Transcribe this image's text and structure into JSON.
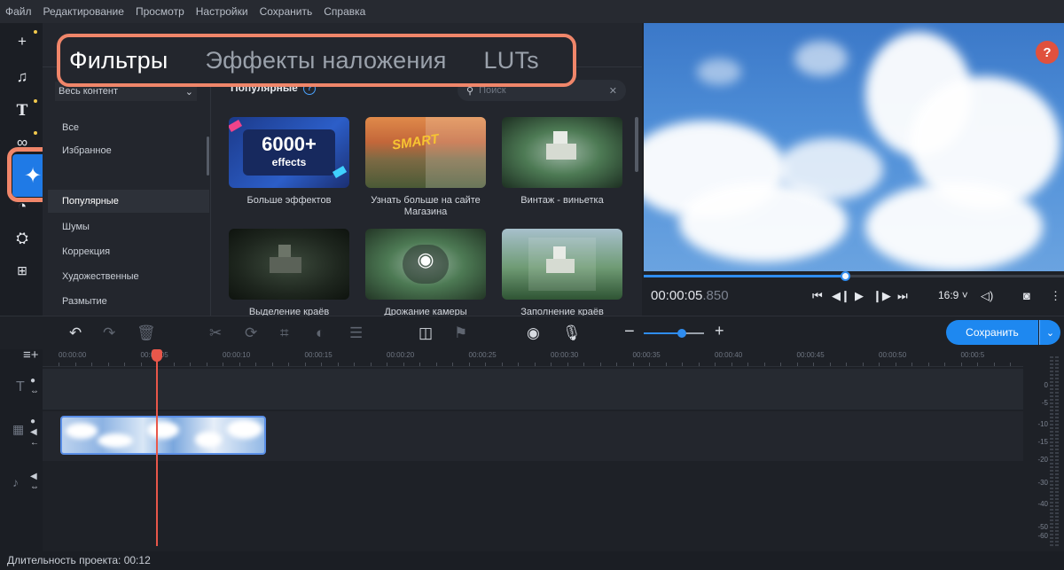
{
  "menu": [
    "Файл",
    "Редактирование",
    "Просмотр",
    "Настройки",
    "Сохранить",
    "Справка"
  ],
  "rail": {
    "icons": [
      "add-media-icon",
      "music-icon",
      "titles-icon",
      "transitions-icon",
      "filters-icon",
      "stickers-icon",
      "callouts-icon",
      "more-tools-icon"
    ]
  },
  "panel": {
    "tabs": [
      {
        "label": "Фильтры",
        "active": true
      },
      {
        "label": "Эффекты наложения",
        "active": false
      },
      {
        "label": "LUTs",
        "active": false
      }
    ],
    "content_filter": "Весь контент",
    "categories": [
      "Все",
      "Избранное",
      "Популярные",
      "Шумы",
      "Коррекция",
      "Художественные",
      "Размытие"
    ],
    "selected_category": "Популярные",
    "section_title": "Популярные",
    "search_placeholder": "Поиск",
    "tiles": [
      {
        "label": "Больше эффектов",
        "badge_main": "6000+",
        "badge_sub": "effects"
      },
      {
        "label": "Узнать больше на сайте Магазина",
        "badge_main": "SMART"
      },
      {
        "label": "Винтаж - виньетка"
      },
      {
        "label": "Выделение краёв"
      },
      {
        "label": "Дрожание камеры"
      },
      {
        "label": "Заполнение краёв"
      }
    ]
  },
  "player": {
    "timecode_main": "00:00:05",
    "timecode_ms": ".850",
    "aspect": "16:9 ˅",
    "progress_fraction": 0.48,
    "help": "?"
  },
  "timeline": {
    "save_label": "Сохранить",
    "ruler": [
      "00:00:00",
      "00:00:05",
      "00:00:10",
      "00:00:15",
      "00:00:20",
      "00:00:25",
      "00:00:30",
      "00:00:35",
      "00:00:40",
      "00:00:45",
      "00:00:50",
      "00:00:5"
    ],
    "meter": [
      "0",
      "-5",
      "-10",
      "-15",
      "-20",
      "-30",
      "-40",
      "-50",
      "-60"
    ],
    "zoom_minus": "−",
    "zoom_plus": "+"
  },
  "status": {
    "duration_label": "Длительность проекта: 00:12"
  }
}
